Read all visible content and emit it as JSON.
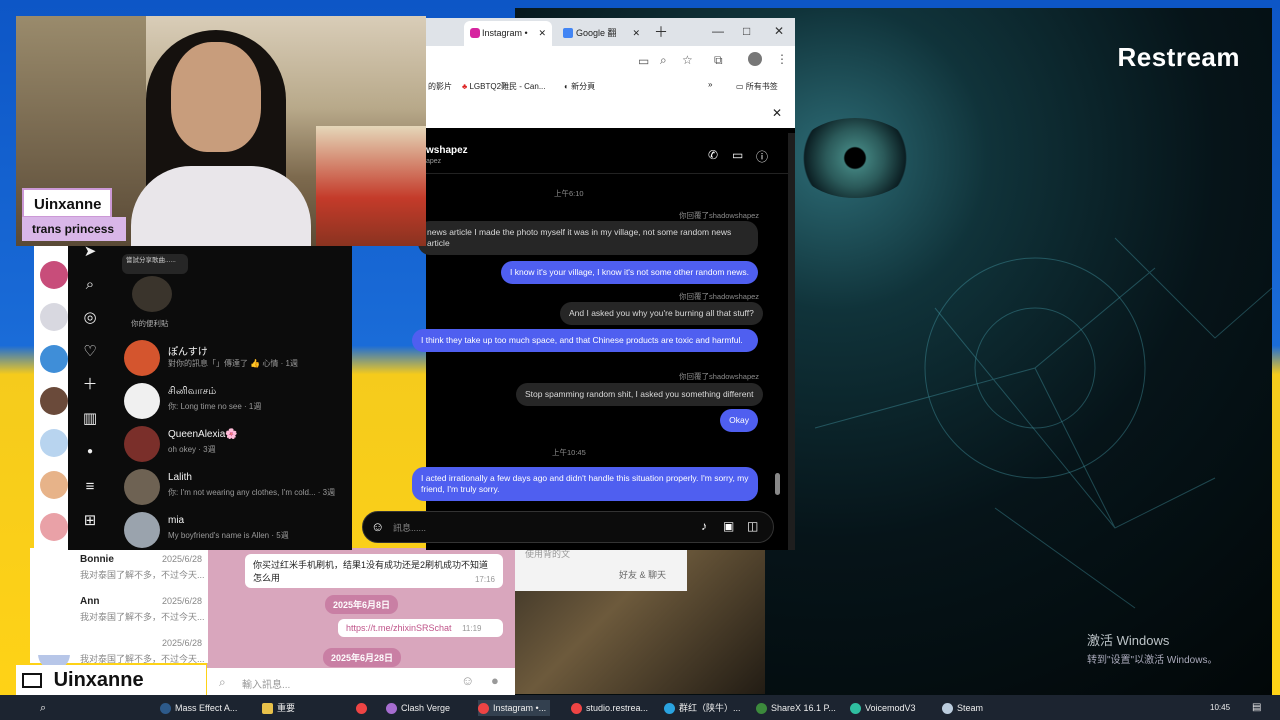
{
  "overlay": {
    "restream": "Restream",
    "webcam_name": "Uinxanne",
    "webcam_subtitle": "trans princess",
    "brand_label": "Uinxanne"
  },
  "windows_activation": {
    "title": "激活 Windows",
    "subtitle": "转到\"设置\"以激活 Windows。"
  },
  "browser": {
    "tabs": [
      {
        "label": "Instagram •"
      },
      {
        "label": "Google 翻"
      }
    ],
    "bookmarks": [
      "的影片",
      "LGBTQ2難民 - Can...",
      "新分頁",
      "所有书签"
    ],
    "window_controls": {
      "minimize": "—",
      "maximize": "□",
      "close": "✕"
    }
  },
  "instagram": {
    "chat_header": {
      "name": "wshapez",
      "sub": "apez"
    },
    "timestamps": [
      "上午6:10",
      "上午10:45"
    ],
    "messages": [
      {
        "side": "meta",
        "text": "你回覆了shadowshapez"
      },
      {
        "side": "left",
        "text": "news article I made the photo myself it was in my village, not some random news article"
      },
      {
        "side": "right",
        "text": "I know it's your village, I know it's not some other random news."
      },
      {
        "side": "meta",
        "text": "你回覆了shadowshapez"
      },
      {
        "side": "left",
        "text": "And I asked you why you're burning all that stuff?"
      },
      {
        "side": "right",
        "text": "I think they take up too much space, and that Chinese products are toxic and harmful."
      },
      {
        "side": "meta",
        "text": "你回覆了shadowshapez"
      },
      {
        "side": "left",
        "text": "Stop spamming random shit, I asked you something different"
      },
      {
        "side": "right",
        "text": "Okay"
      },
      {
        "side": "right",
        "text": "I acted irrationally a few days ago and didn't handle this situation properly. I'm sorry, my friend, I'm truly sorry."
      }
    ],
    "composer_placeholder": "訊息......",
    "notes": {
      "pill": "嘗試分享歌曲......",
      "caption": "你的便利貼"
    },
    "conversations": [
      {
        "name": "ぽんすけ",
        "preview": "對你的訊息「」傳達了 👍 心情 · 1週"
      },
      {
        "name": "சினிவாசம்",
        "preview": "你: Long time no see · 1週"
      },
      {
        "name": "QueenAlexia🌸",
        "preview": "oh okey · 3週"
      },
      {
        "name": "Lalith",
        "preview": "你: I'm not wearing any clothes, I'm cold... · 3週"
      },
      {
        "name": "mia",
        "preview": "My boyfriend's name is Allen · 5週"
      }
    ]
  },
  "telegram": {
    "chats": [
      {
        "name": "Bonnie",
        "date": "2025/6/28",
        "preview": "我对泰国了解不多，不过今天..."
      },
      {
        "name": "Ann",
        "date": "2025/6/28",
        "preview": "我对泰国了解不多，不过今天..."
      },
      {
        "name": "",
        "date": "2025/6/28",
        "preview": "我对泰国了解不多，不过今天..."
      }
    ],
    "bubble1": "你买过红米手机刷机，结果1没有成功还是2刷机成功不知道怎么用",
    "bubble1_time": "17:16",
    "date1": "2025年6月8日",
    "link": "https://t.me/zhixinSRSchat",
    "link_time": "11:19",
    "date2": "2025年6月28日",
    "input_placeholder": "輸入訊息...",
    "side_text": "好友 & 聊天",
    "top_text": "使用背的文"
  },
  "taskbar": {
    "items": [
      "Mass Effect A...",
      "重要",
      "Clash Verge",
      "Instagram •...",
      "studio.restrea...",
      "群红（陕牛）...",
      "ShareX 16.1 P...",
      "VoicemodV3",
      "Steam"
    ],
    "time": "10:45"
  }
}
